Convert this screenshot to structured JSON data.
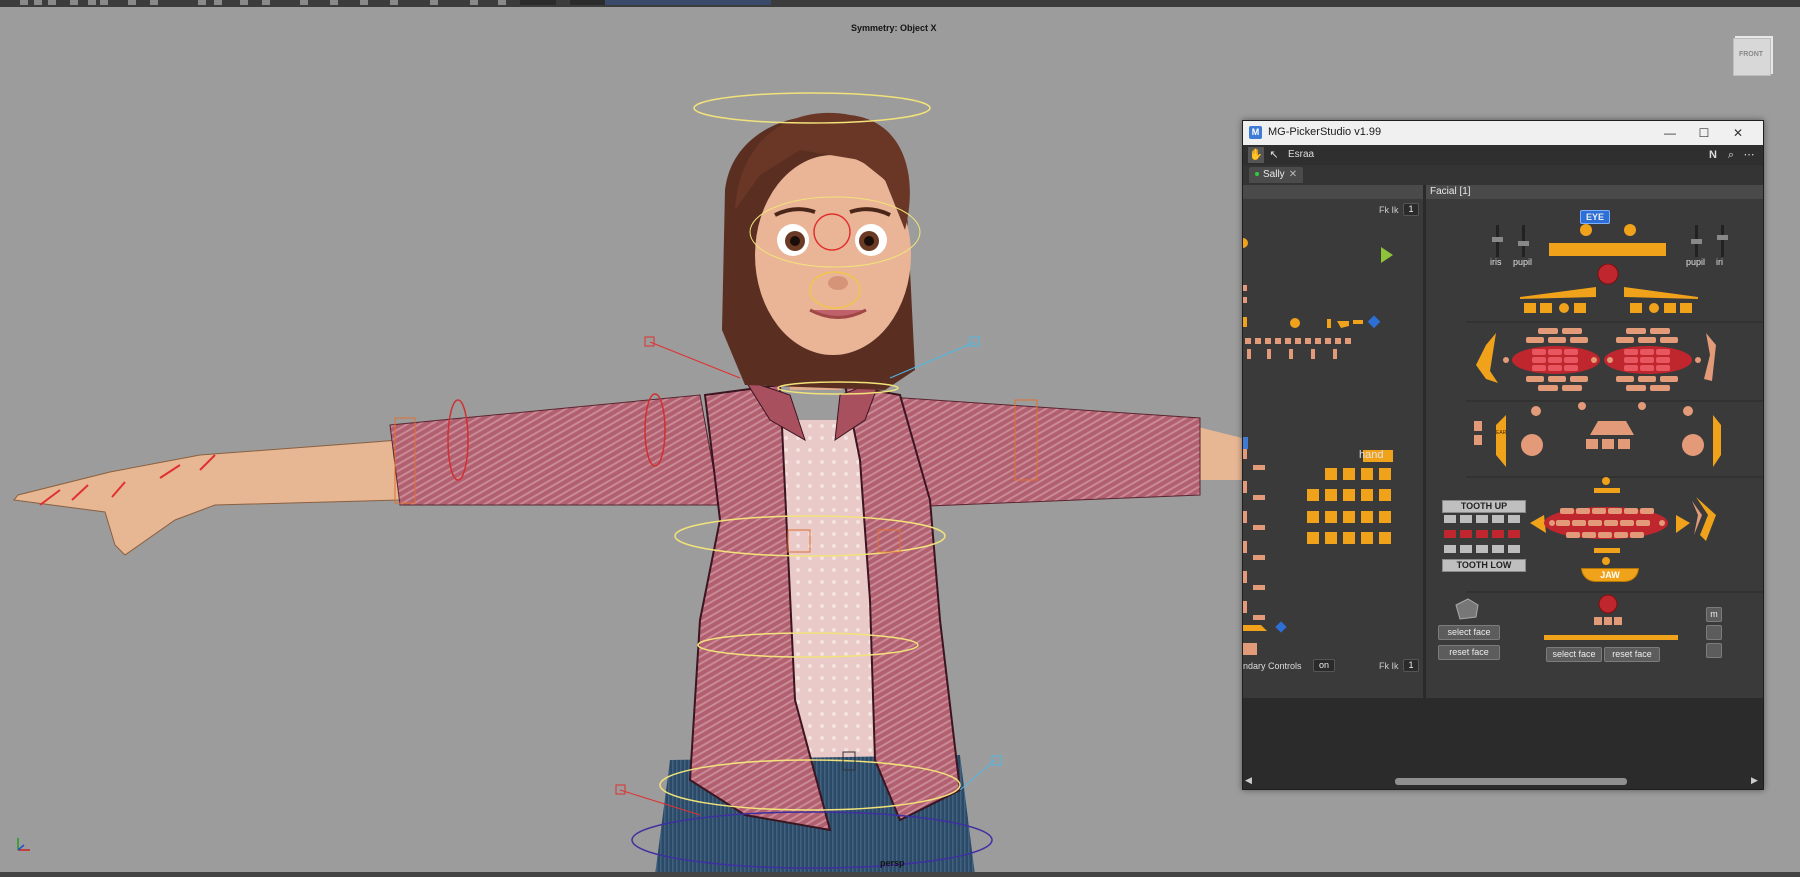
{
  "viewport": {
    "symmetry_label": "Symmetry: Object X",
    "camera_label": "persp",
    "viewcube_label": "FRONT"
  },
  "picker": {
    "title": "MG-PickerStudio v1.99",
    "app_icon": "M",
    "window_buttons": {
      "minimize": "—",
      "maximize": "☐",
      "close": "✕"
    },
    "toolbar": {
      "user": "Esraa",
      "icons": [
        "hand-icon",
        "cursor-icon",
        "n-icon",
        "search-icon",
        "more-icon"
      ]
    },
    "tab": {
      "label": "Sally",
      "close": "✕"
    },
    "left_panel": {
      "fk_ik_top": "Fk Ik",
      "fk_ik_top_value": "1",
      "fk_ik_bottom": "Fk Ik",
      "fk_ik_bottom_value": "1",
      "hand_label": "hand",
      "boundary_label": "ndary Controls",
      "boundary_value": "on"
    },
    "right_panel": {
      "header": "Facial [1]",
      "eye_button": "EYE",
      "iris_label_left": "iris",
      "pupil_label_left": "pupil",
      "pupil_label_right": "pupil",
      "iris_label_right": "iri",
      "tooth_up": "TOOTH UP",
      "tooth_low": "TOOTH LOW",
      "jaw_button": "JAW",
      "ear_label_left": "EAR",
      "select_face_left": "select face",
      "reset_face_left": "reset face",
      "select_face_right": "select face",
      "reset_face_right": "reset face",
      "edge_buttons": [
        "m",
        "",
        ""
      ]
    },
    "colors": {
      "accent_orange": "#f0a21b",
      "control_red": "#c0262e",
      "control_salmon": "#e39a78",
      "eye_blue": "#2e6fd6"
    }
  }
}
